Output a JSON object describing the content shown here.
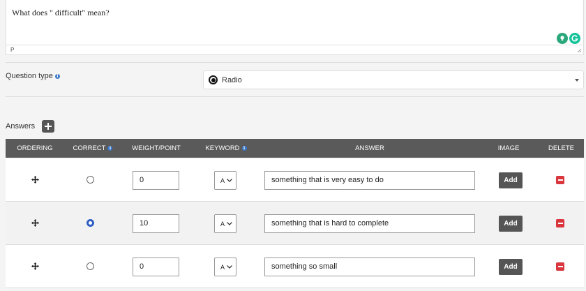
{
  "editor": {
    "content": "What does \" difficult\" mean?",
    "status_path": "P"
  },
  "question_type": {
    "label": "Question type",
    "selected": "Radio"
  },
  "answers": {
    "title": "Answers",
    "columns": {
      "ordering": "ORDERING",
      "correct": "CORRECT",
      "weight": "WEIGHT/POINT",
      "keyword": "KEYWORD",
      "answer": "ANSWER",
      "image": "IMAGE",
      "delete": "DELETE"
    },
    "rows": [
      {
        "correct": false,
        "weight": "0",
        "keyword": "A",
        "answer": "something that is very easy to do",
        "image_label": "Add"
      },
      {
        "correct": true,
        "weight": "10",
        "keyword": "A",
        "answer": "something that is hard to complete",
        "image_label": "Add"
      },
      {
        "correct": false,
        "weight": "0",
        "keyword": "A",
        "answer": "something so small",
        "image_label": "Add"
      }
    ]
  },
  "colors": {
    "header_bg": "#5a5a5a",
    "selected_radio": "#2f5ec4",
    "delete": "#d9363e",
    "info": "#3a78c9"
  }
}
